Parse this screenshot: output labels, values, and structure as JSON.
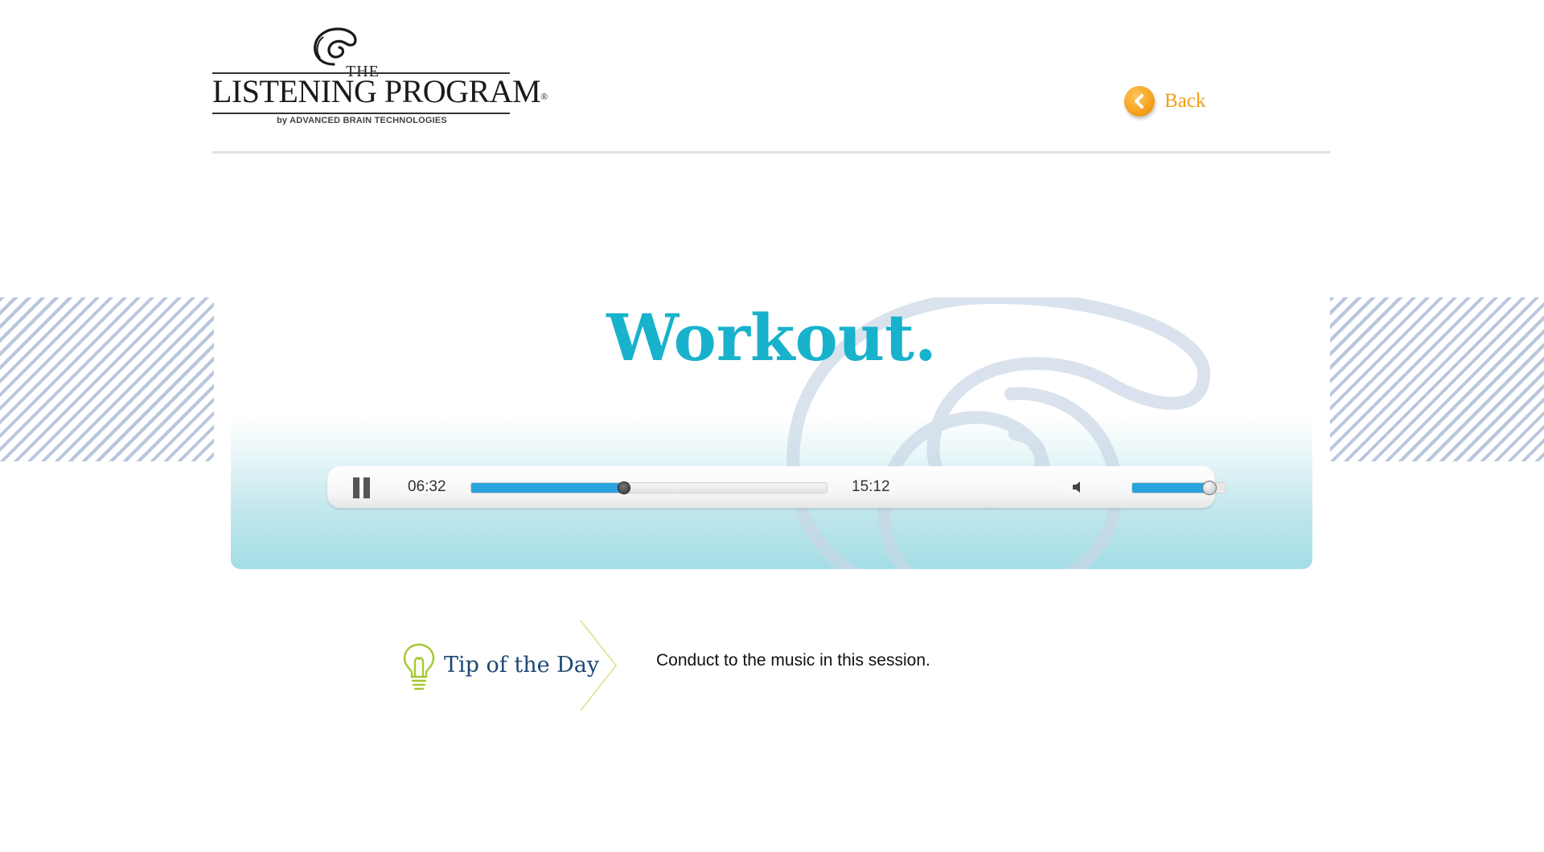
{
  "header": {
    "logo": {
      "the": "THE",
      "name": "LISTENING PROGRAM",
      "registered": "®",
      "byline": "by ADVANCED BRAIN TECHNOLOGIES",
      "icon": "nautilus-shell-icon"
    },
    "back": {
      "label": "Back",
      "icon": "chevron-left-circle-icon",
      "color": "#f29d17"
    }
  },
  "hero": {
    "title": "Workout.",
    "title_color": "#18b2cc",
    "background_icon": "nautilus-shell-icon"
  },
  "player": {
    "state": "playing",
    "pause_icon": "pause-icon",
    "current_time": "06:32",
    "total_time": "15:12",
    "progress_fraction": 0.43,
    "volume_icon": "speaker-icon",
    "volume_fraction": 0.83,
    "accent": "#2aa2dc"
  },
  "tip": {
    "icon": "lightbulb-icon",
    "title": "Tip of the Day",
    "text": "Conduct to the music in this session."
  }
}
